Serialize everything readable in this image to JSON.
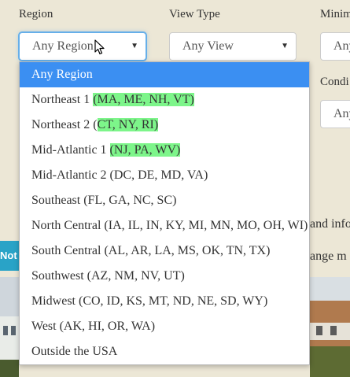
{
  "filters": {
    "region": {
      "label": "Region",
      "value": "Any Region"
    },
    "view_type": {
      "label": "View Type",
      "value": "Any View"
    },
    "minimum": {
      "label": "Minim",
      "value": "Any"
    },
    "condition": {
      "label": "Condi",
      "value": "Any"
    }
  },
  "background": {
    "badge_text": "Not",
    "line1": "and info",
    "line2": "ange m"
  },
  "dropdown": {
    "options": [
      {
        "pre": "Any Region",
        "hl": "",
        "post": ""
      },
      {
        "pre": "Northeast 1 ",
        "hl": "(MA, ME, NH, VT)",
        "post": ""
      },
      {
        "pre": "Northeast 2 (",
        "hl": "CT, NY, RI)",
        "post": ""
      },
      {
        "pre": "Mid-Atlantic 1 ",
        "hl": "(NJ, PA, WV)",
        "post": ""
      },
      {
        "pre": "Mid-Atlantic 2 (DC, DE, MD, VA)",
        "hl": "",
        "post": ""
      },
      {
        "pre": "Southeast (FL, GA, NC, SC)",
        "hl": "",
        "post": ""
      },
      {
        "pre": "North Central (IA, IL, IN, KY, MI, MN, MO, OH, WI)",
        "hl": "",
        "post": ""
      },
      {
        "pre": "South Central (AL, AR, LA, MS, OK, TN, TX)",
        "hl": "",
        "post": ""
      },
      {
        "pre": "Southwest (AZ, NM, NV, UT)",
        "hl": "",
        "post": ""
      },
      {
        "pre": "Midwest (CO, ID, KS, MT, ND, NE, SD, WY)",
        "hl": "",
        "post": ""
      },
      {
        "pre": "West (AK, HI, OR, WA)",
        "hl": "",
        "post": ""
      },
      {
        "pre": "Outside the USA",
        "hl": "",
        "post": ""
      }
    ]
  },
  "colors": {
    "accent": "#3b8ff2",
    "highlight": "#7df58a",
    "badge": "#29a3c7"
  },
  "icons": {
    "caret": "caret-down-icon",
    "cursor": "mouse-pointer-icon"
  }
}
